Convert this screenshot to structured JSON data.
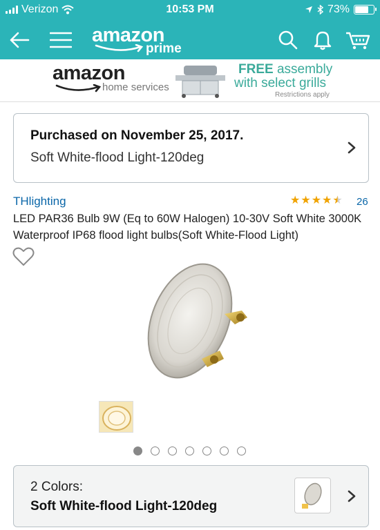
{
  "status": {
    "carrier": "Verizon",
    "time": "10:53 PM",
    "battery": "73%",
    "battery_level": 0.73
  },
  "nav": {
    "logo_word": "amazon",
    "logo_sub": "prime",
    "icons": [
      "back-arrow-icon",
      "menu-icon",
      "search-icon",
      "bell-icon",
      "cart-icon"
    ]
  },
  "banner": {
    "brand_word": "amazon",
    "brand_sub": "home services",
    "promo_free": "FREE",
    "promo_line1_rest": " assembly",
    "promo_line2": "with select grills",
    "promo_restriction": "Restrictions apply"
  },
  "purchase": {
    "title": "Purchased on November 25, 2017.",
    "variant": "Soft White-flood Light-120deg"
  },
  "product": {
    "brand": "THlighting",
    "rating": 4.5,
    "review_count": "26",
    "title": "LED PAR36 Bulb 9W (Eq to 60W Halogen) 10-30V Soft White 3000K Waterproof IP68 flood light bulbs(Soft White-Flood Light)",
    "image_count": 7,
    "active_image": 1
  },
  "colors": {
    "count_label": "2 Colors:",
    "selected": "Soft White-flood Light-120deg"
  },
  "theme": {
    "teal": "#2bb4b8",
    "link": "#0a66a8",
    "star": "#f0a300"
  }
}
